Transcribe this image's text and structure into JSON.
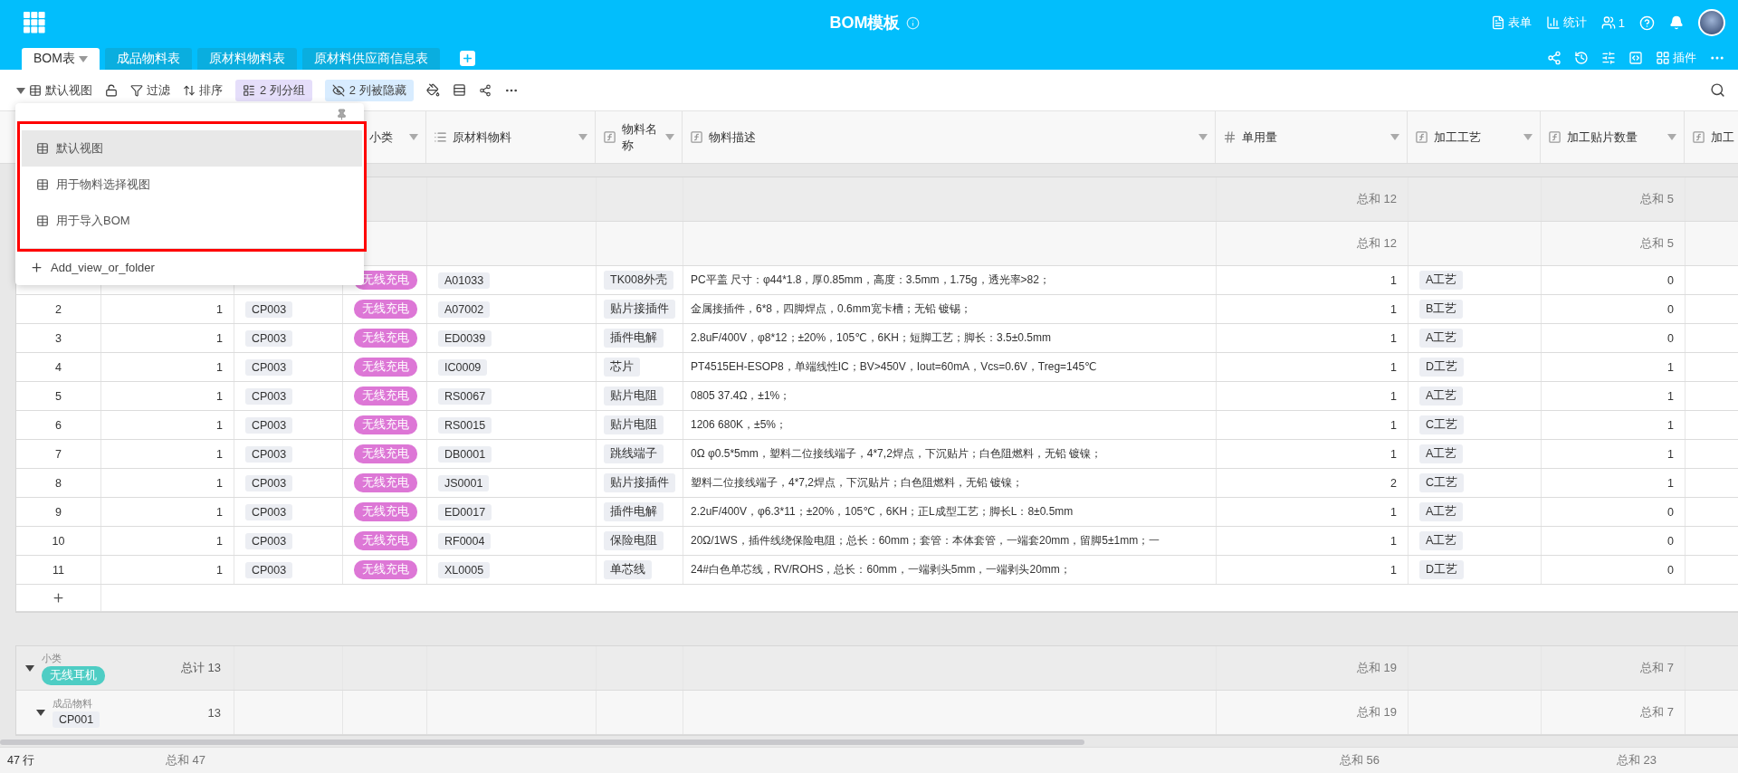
{
  "app": {
    "title": "BOM模板",
    "actions": [
      {
        "kind": "form",
        "label": "表单"
      },
      {
        "kind": "stats",
        "label": "统计"
      },
      {
        "kind": "members",
        "label": "1"
      }
    ],
    "tools_label": "插件"
  },
  "tabs": [
    {
      "label": "BOM表",
      "selected": true
    },
    {
      "label": "成品物料表",
      "selected": false
    },
    {
      "label": "原材料物料表",
      "selected": false
    },
    {
      "label": "原材料供应商信息表",
      "selected": false
    }
  ],
  "toolbar": {
    "view": {
      "label": "默认视图",
      "expanded": true
    },
    "actions": [
      {
        "kind": "filter",
        "label": "过滤"
      },
      {
        "kind": "sort",
        "label": "排序"
      }
    ],
    "chips": [
      {
        "kind": "group",
        "label": "2 列分组"
      },
      {
        "kind": "hidden",
        "label": "2 列被隐藏"
      }
    ]
  },
  "view_menu": {
    "items": [
      {
        "label": "默认视图",
        "selected": true
      },
      {
        "label": "用于物料选择视图",
        "selected": false
      },
      {
        "label": "用于导入BOM",
        "selected": false
      }
    ],
    "add_label": "Add_view_or_folder"
  },
  "columns": [
    {
      "label": "小类"
    },
    {
      "label": "原材料物料",
      "kind": "link"
    },
    {
      "label": "物料名称",
      "kind": "formula"
    },
    {
      "label": "物料描述",
      "kind": "formula"
    },
    {
      "label": "单用量",
      "kind": "number"
    },
    {
      "label": "加工工艺",
      "kind": "formula"
    },
    {
      "label": "加工贴片数量",
      "kind": "formula"
    },
    {
      "label": "加工",
      "kind": "formula"
    }
  ],
  "groups": [
    {
      "usage_sum": "总和 12",
      "smt_sum": "总和 5",
      "subgroups": [
        {
          "usage_sum": "总和 12",
          "smt_sum": "总和 5",
          "rows": [
            {
              "category": {
                "text": "无线充电",
                "color": "#dd77d6"
              },
              "material": "A01033",
              "name": "TK008外壳",
              "description": "PC平盖 尺寸：φ44*1.8，厚0.85mm，高度：3.5mm，1.75g，透光率>82；",
              "usage": "1",
              "process": "A工艺",
              "smt": "0"
            },
            {
              "index": "2",
              "qty": "1",
              "product": "CP003",
              "category": {
                "text": "无线充电",
                "color": "#dd77d6"
              },
              "material": "A07002",
              "name": "贴片接插件",
              "description": "金属接插件，6*8，四脚焊点，0.6mm宽卡槽；无铅 镀锡；",
              "usage": "1",
              "process": "B工艺",
              "smt": "0"
            },
            {
              "index": "3",
              "qty": "1",
              "product": "CP003",
              "category": {
                "text": "无线充电",
                "color": "#dd77d6"
              },
              "material": "ED0039",
              "name": "插件电解",
              "description": "2.8uF/400V，φ8*12；±20%，105℃，6KH；短脚工艺；脚长：3.5±0.5mm",
              "usage": "1",
              "process": "A工艺",
              "smt": "0"
            },
            {
              "index": "4",
              "qty": "1",
              "product": "CP003",
              "category": {
                "text": "无线充电",
                "color": "#dd77d6"
              },
              "material": "IC0009",
              "name": "芯片",
              "description": "PT4515EH-ESOP8，单端线性IC；BV>450V，Iout=60mA，Vcs=0.6V，Treg=145℃",
              "usage": "1",
              "process": "D工艺",
              "smt": "1"
            },
            {
              "index": "5",
              "qty": "1",
              "product": "CP003",
              "category": {
                "text": "无线充电",
                "color": "#dd77d6"
              },
              "material": "RS0067",
              "name": "贴片电阻",
              "description": "0805   37.4Ω，±1%；",
              "usage": "1",
              "process": "A工艺",
              "smt": "1"
            },
            {
              "index": "6",
              "qty": "1",
              "product": "CP003",
              "category": {
                "text": "无线充电",
                "color": "#dd77d6"
              },
              "material": "RS0015",
              "name": "贴片电阻",
              "description": "1206   680K，±5%；",
              "usage": "1",
              "process": "C工艺",
              "smt": "1"
            },
            {
              "index": "7",
              "qty": "1",
              "product": "CP003",
              "category": {
                "text": "无线充电",
                "color": "#dd77d6"
              },
              "material": "DB0001",
              "name": "跳线端子",
              "description": "0Ω φ0.5*5mm，塑料二位接线端子，4*7,2焊点，下沉贴片；白色阻燃料，无铅 镀镍；",
              "usage": "1",
              "process": "A工艺",
              "smt": "1"
            },
            {
              "index": "8",
              "qty": "1",
              "product": "CP003",
              "category": {
                "text": "无线充电",
                "color": "#dd77d6"
              },
              "material": "JS0001",
              "name": "贴片接插件",
              "description": "塑料二位接线端子，4*7,2焊点，下沉贴片；白色阻燃料，无铅 镀镍；",
              "usage": "2",
              "process": "C工艺",
              "smt": "1"
            },
            {
              "index": "9",
              "qty": "1",
              "product": "CP003",
              "category": {
                "text": "无线充电",
                "color": "#dd77d6"
              },
              "material": "ED0017",
              "name": "插件电解",
              "description": "2.2uF/400V，φ6.3*11；±20%，105℃，6KH；正L成型工艺；脚长L：8±0.5mm",
              "usage": "1",
              "process": "A工艺",
              "smt": "0"
            },
            {
              "index": "10",
              "qty": "1",
              "product": "CP003",
              "category": {
                "text": "无线充电",
                "color": "#dd77d6"
              },
              "material": "RF0004",
              "name": "保险电阻",
              "description": "20Ω/1WS，插件线绕保险电阻；总长：60mm；套管：本体套管，一端套20mm，留脚5±1mm；一",
              "usage": "1",
              "process": "A工艺",
              "smt": "0"
            },
            {
              "index": "11",
              "qty": "1",
              "product": "CP003",
              "category": {
                "text": "无线充电",
                "color": "#dd77d6"
              },
              "material": "XL0005",
              "name": "单芯线",
              "description": "24#白色单芯线，RV/ROHS，总长：60mm，一端剥头5mm，一端剥头20mm；",
              "usage": "1",
              "process": "D工艺",
              "smt": "0"
            }
          ]
        }
      ]
    },
    {
      "expanded": true,
      "field": "小类",
      "tag": {
        "text": "无线耳机",
        "color": "#4ecdc4"
      },
      "count": "总计 13",
      "usage_sum": "总和 19",
      "smt_sum": "总和 7",
      "subgroups": [
        {
          "expanded": true,
          "field": "成品物料",
          "tag": {
            "text": "CP001"
          },
          "count": "13",
          "usage_sum": "总和 19",
          "smt_sum": "总和 7"
        }
      ]
    }
  ],
  "footer": {
    "rows": "47 行",
    "qty_sum": "总和 47",
    "usage_sum": "总和 56",
    "smt_sum": "总和 23"
  }
}
